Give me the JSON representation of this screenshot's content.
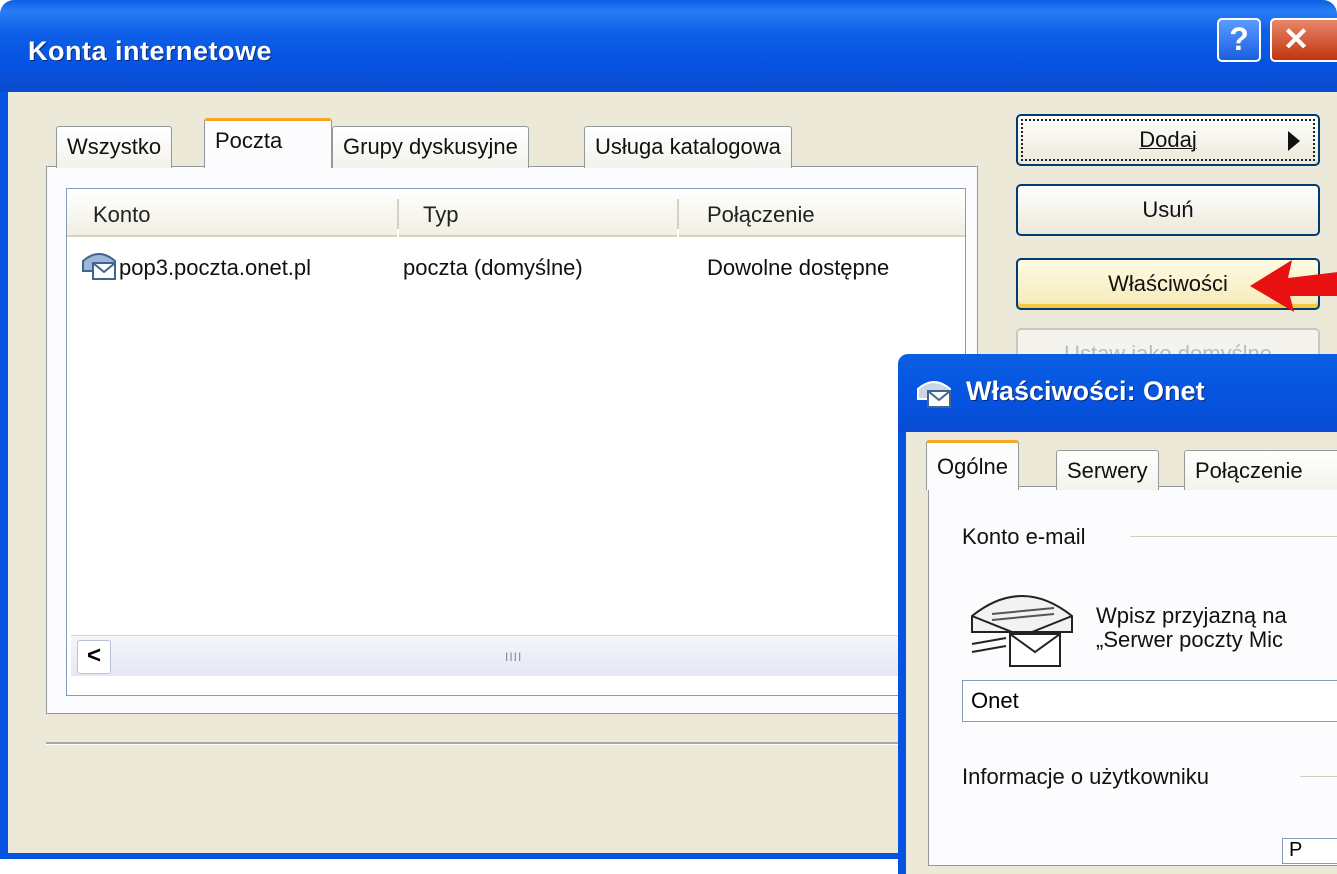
{
  "main_window": {
    "title": "Konta internetowe",
    "help_glyph": "?",
    "close_glyph": "✕",
    "tabs": [
      "Wszystko",
      "Poczta",
      "Grupy dyskusyjne",
      "Usługa katalogowa"
    ],
    "active_tab": "Poczta",
    "list": {
      "columns": [
        "Konto",
        "Typ",
        "Połączenie"
      ],
      "rows": [
        {
          "account": "pop3.poczta.onet.pl",
          "type": "poczta (domyślne)",
          "connection": "Dowolne dostępne",
          "icon": "mail-account-icon"
        }
      ],
      "scroll_left_glyph": "<",
      "scroll_thumb_glyph": "IIII"
    },
    "buttons": {
      "add": "Dodaj",
      "remove": "Usuń",
      "properties": "Właściwości",
      "set_default_partial": "Ustaw jako domyślne"
    },
    "accent_color": "#0553e0"
  },
  "properties_dialog": {
    "title": "Właściwości: Onet",
    "tabs": [
      "Ogólne",
      "Serwery",
      "Połączenie"
    ],
    "active_tab": "Ogólne",
    "group_mail": "Konto e-mail",
    "description_line1": "Wpisz przyjazną na",
    "description_line2": "„Serwer poczty Mic",
    "account_name_value": "Onet",
    "group_user": "Informacje o użytkowniku",
    "partial_field_value": "P"
  },
  "annotation": {
    "arrow_color": "#e81010",
    "arrow_target": "Właściwości"
  }
}
